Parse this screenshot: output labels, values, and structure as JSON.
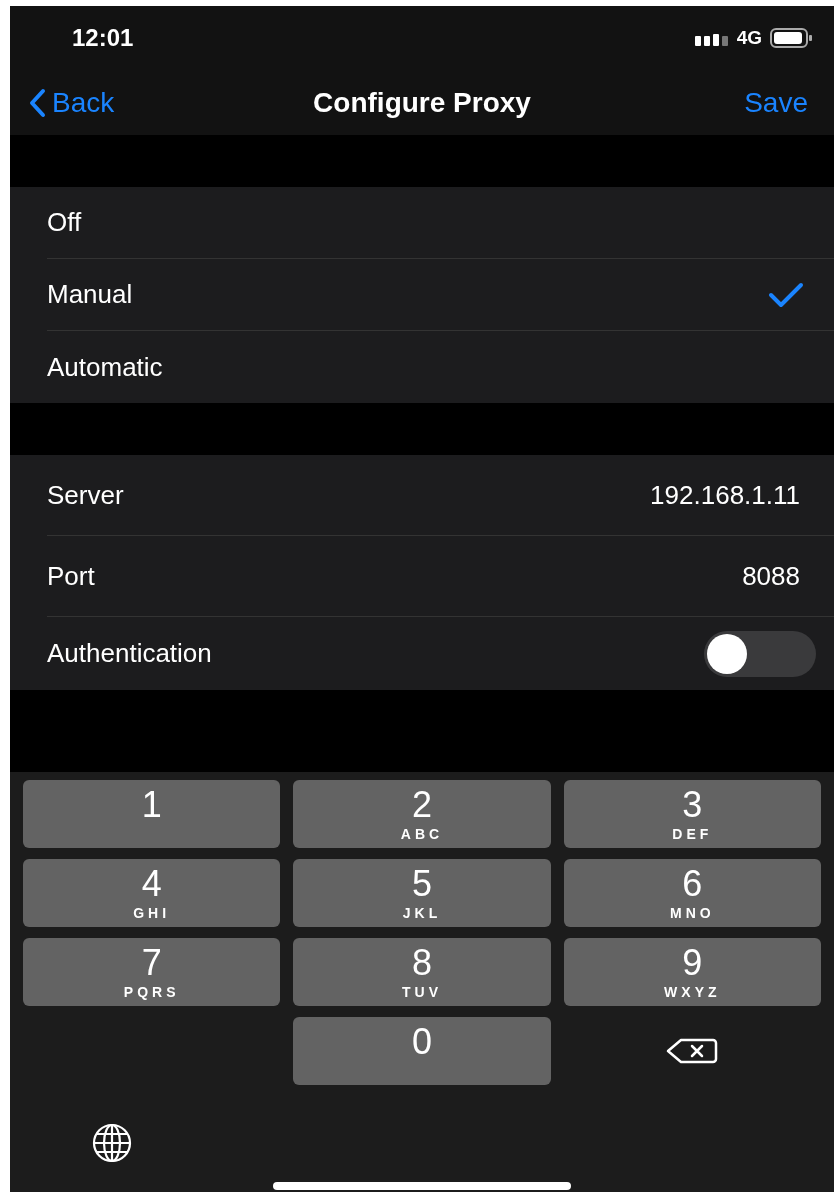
{
  "status_bar": {
    "time": "12:01",
    "network": "4G"
  },
  "nav": {
    "back": "Back",
    "title": "Configure Proxy",
    "action": "Save"
  },
  "modes": [
    {
      "label": "Off",
      "selected": false
    },
    {
      "label": "Manual",
      "selected": true
    },
    {
      "label": "Automatic",
      "selected": false
    }
  ],
  "fields": [
    {
      "kind": "text",
      "label": "Server",
      "value": "192.168.1.11"
    },
    {
      "kind": "text",
      "label": "Port",
      "value": "8088"
    },
    {
      "kind": "toggle",
      "label": "Authentication",
      "on": false
    }
  ],
  "keypad": [
    {
      "digit": "1"
    },
    {
      "digit": "2",
      "letters": "ABC"
    },
    {
      "digit": "3",
      "letters": "DEF"
    },
    {
      "digit": "4",
      "letters": "GHI"
    },
    {
      "digit": "5",
      "letters": "JKL"
    },
    {
      "digit": "6",
      "letters": "MNO"
    },
    {
      "digit": "7",
      "letters": "PQRS"
    },
    {
      "digit": "8",
      "letters": "TUV"
    },
    {
      "digit": "9",
      "letters": "WXYZ"
    },
    {
      "digit": "0"
    }
  ]
}
